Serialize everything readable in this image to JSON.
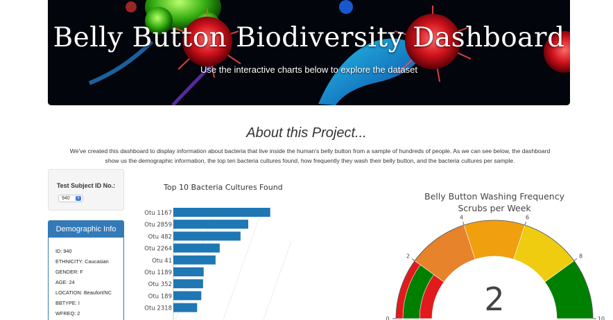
{
  "hero": {
    "title": "Belly Button Biodiversity Dashboard",
    "subtitle": "Use the interactive charts below to explore the dataset"
  },
  "about": {
    "title": "About this Project...",
    "text": "We've created this dashboard to display information about bacteria that live inside the human's belly button from a sample of hundreds of people. As we can see below, the dashboard show us the demographic information, the top ten bacteria cultures found, how frequently they wash their belly button, and the bacteria cultures per sample."
  },
  "selector": {
    "label": "Test Subject ID No.:",
    "selected": "940"
  },
  "demographics": {
    "heading": "Demographic Info",
    "rows": [
      "ID: 940",
      "ETHNICITY: Caucasian",
      "GENDER: F",
      "AGE: 24",
      "LOCATION: Beaufort/NC",
      "BBTYPE: I",
      "WFREQ: 2"
    ]
  },
  "colors": {
    "bar": "#1f77b4",
    "panel": "#337ab7",
    "gauge_red": "#e31a1c",
    "gauge_green": "#008000",
    "gauge_orange_dark": "#e6832b",
    "gauge_orange": "#f0a00f",
    "gauge_yellow": "#efcc10"
  },
  "chart_data": [
    {
      "type": "bar",
      "orientation": "horizontal",
      "title": "Top 10 Bacteria Cultures Found",
      "categories": [
        "Otu 1167",
        "Otu 2859",
        "Otu 482",
        "Otu 2264",
        "Otu 41",
        "Otu 1189",
        "Otu 352",
        "Otu 189",
        "Otu 2318"
      ],
      "values": [
        163,
        126,
        113,
        78,
        71,
        51,
        50,
        47,
        40
      ],
      "xlim": [
        0,
        175
      ]
    },
    {
      "type": "gauge",
      "title": "Belly Button Washing Frequency",
      "subtitle": "Scrubs per Week",
      "value": 2,
      "range": [
        0,
        10
      ],
      "ticks": [
        "0",
        "2",
        "4",
        "6",
        "8",
        "10"
      ],
      "steps": [
        {
          "range": [
            0,
            2
          ],
          "color": "#e31a1c"
        },
        {
          "range": [
            2,
            4
          ],
          "color": "#e6832b"
        },
        {
          "range": [
            4,
            6
          ],
          "color": "#f0a00f"
        },
        {
          "range": [
            6,
            8
          ],
          "color": "#efcc10"
        },
        {
          "range": [
            8,
            10
          ],
          "color": "#008000"
        }
      ]
    }
  ]
}
